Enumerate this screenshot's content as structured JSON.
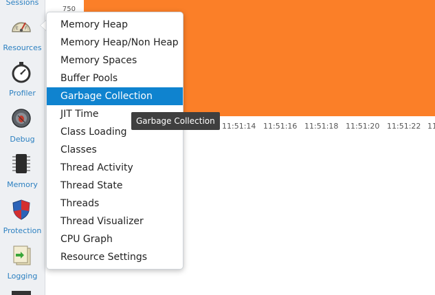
{
  "sidebar": {
    "items": [
      {
        "label": "Sessions",
        "icon": "sessions-icon"
      },
      {
        "label": "Resources",
        "icon": "gauge-icon"
      },
      {
        "label": "Profiler",
        "icon": "stopwatch-icon"
      },
      {
        "label": "Debug",
        "icon": "bug-icon"
      },
      {
        "label": "Memory",
        "icon": "chip-icon"
      },
      {
        "label": "Protection",
        "icon": "shield-icon"
      },
      {
        "label": "Logging",
        "icon": "log-icon"
      }
    ]
  },
  "chart": {
    "fill_color": "#fb7f28",
    "y_tick": "750",
    "x_ticks": [
      "11:51:14",
      "11:51:16",
      "11:51:18",
      "11:51:20",
      "11:51:22",
      "11"
    ]
  },
  "menu": {
    "items": [
      "Memory Heap",
      "Memory Heap/Non Heap",
      "Memory Spaces",
      "Buffer Pools",
      "Garbage Collection",
      "JIT Time",
      "Class Loading",
      "Classes",
      "Thread Activity",
      "Thread State",
      "Threads",
      "Thread Visualizer",
      "CPU Graph",
      "Resource Settings"
    ],
    "selected": "Garbage Collection",
    "selected_color": "#0f83cf"
  },
  "tooltip": {
    "text": "Garbage Collection"
  }
}
